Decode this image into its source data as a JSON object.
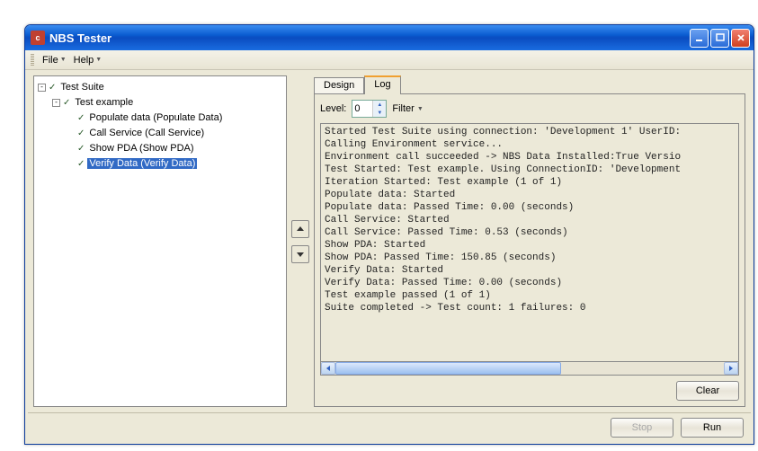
{
  "window": {
    "title": "NBS Tester"
  },
  "menu": {
    "file": "File",
    "help": "Help"
  },
  "tree": {
    "root": {
      "label": "Test Suite",
      "toggle": "-"
    },
    "example": {
      "label": "Test example",
      "toggle": "-"
    },
    "items": [
      {
        "label": "Populate data (Populate Data)"
      },
      {
        "label": "Call Service (Call Service)"
      },
      {
        "label": "Show PDA (Show PDA)"
      },
      {
        "label": "Verify Data (Verify Data)",
        "selected": true
      }
    ]
  },
  "tabs": {
    "design": "Design",
    "log": "Log"
  },
  "log_toolbar": {
    "level_label": "Level:",
    "level_value": "0",
    "filter_label": "Filter"
  },
  "log_lines": [
    "Started Test Suite using connection: 'Development 1' UserID:",
    "Calling Environment service...",
    "Environment call succeeded -> NBS Data Installed:True Versio",
    "Test Started: Test example. Using ConnectionID: 'Development",
    "Iteration Started: Test example (1 of 1)",
    "Populate data: Started",
    "Populate data: Passed Time: 0.00 (seconds)",
    "Call Service: Started",
    "Call Service: Passed Time: 0.53 (seconds)",
    "Show PDA: Started",
    "Show PDA: Passed Time: 150.85 (seconds)",
    "Verify Data: Started",
    "Verify Data: Passed Time: 0.00 (seconds)",
    "Test example passed (1 of 1)",
    "Suite completed -> Test count: 1 failures: 0"
  ],
  "buttons": {
    "clear": "Clear",
    "stop": "Stop",
    "run": "Run"
  }
}
